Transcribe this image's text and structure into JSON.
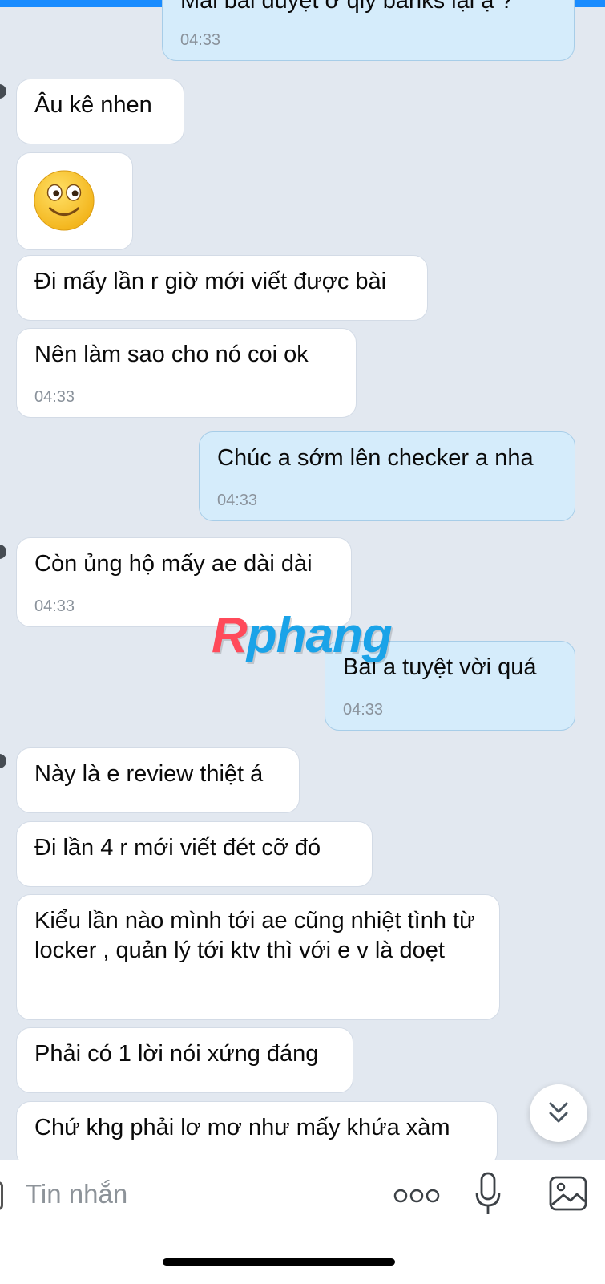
{
  "messages": [
    {
      "id": "m0",
      "dir": "out",
      "text": "Mai bài duyệt ở qly banks lại ạ ?",
      "time": "04:33"
    },
    {
      "id": "m1",
      "dir": "in",
      "text": "Âu kê nhen",
      "time": ""
    },
    {
      "id": "m2",
      "dir": "in",
      "text": "Đi mấy lần r giờ mới viết được bài",
      "time": ""
    },
    {
      "id": "m3",
      "dir": "in",
      "text": "Nên làm sao cho nó coi ok",
      "time": "04:33"
    },
    {
      "id": "m4",
      "dir": "out",
      "text": "Chúc a sớm lên checker a nha",
      "time": "04:33"
    },
    {
      "id": "m5",
      "dir": "in",
      "text": "Còn ủng hộ mấy ae dài dài",
      "time": "04:33"
    },
    {
      "id": "m6",
      "dir": "out",
      "text": "Bài a tuyệt vời quá",
      "time": "04:33"
    },
    {
      "id": "m7",
      "dir": "in",
      "text": "Này là e review thiệt á",
      "time": ""
    },
    {
      "id": "m8",
      "dir": "in",
      "text": "Đi lần 4 r mới viết đét cỡ đó",
      "time": ""
    },
    {
      "id": "m9",
      "dir": "in",
      "text": "Kiểu lần nào mình tới ae cũng nhiệt tình từ locker , quản lý tới ktv thì với e v là doẹt",
      "time": ""
    },
    {
      "id": "m10",
      "dir": "in",
      "text": "Phải có 1 lời nói xứng đáng",
      "time": ""
    },
    {
      "id": "m11",
      "dir": "in",
      "text": "Chứ khg phải lơ mơ như mấy khứa xàm",
      "time": ""
    }
  ],
  "watermark": {
    "prefix": "R",
    "rest": "phang"
  },
  "composer": {
    "placeholder": "Tin nhắn"
  },
  "icons": {
    "smiley": "smiley-sticker-icon",
    "scroll": "chevron-double-down-icon",
    "more": "more-dots-icon",
    "mic": "microphone-icon",
    "image": "image-icon"
  },
  "colors": {
    "accent": "#1a8cff",
    "outgoing_bubble": "#d5ecfb",
    "incoming_bubble": "#ffffff",
    "background": "#e2e8f0"
  }
}
